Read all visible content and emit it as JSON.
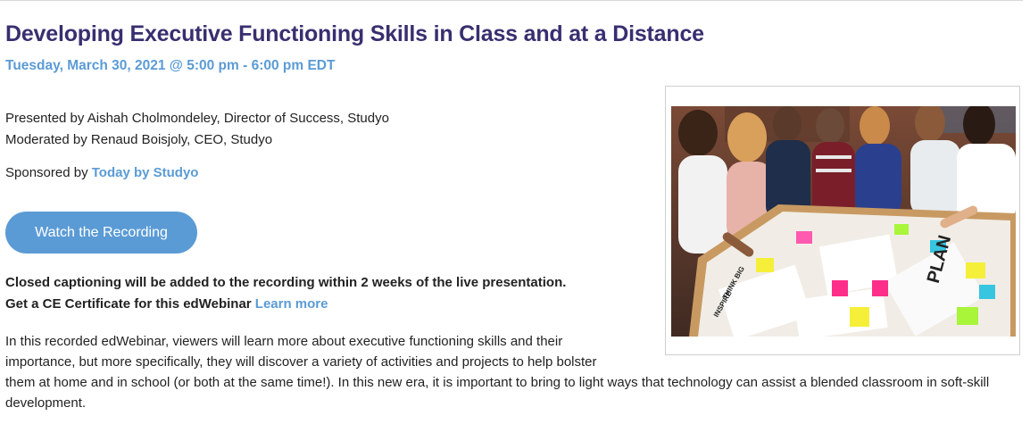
{
  "event": {
    "title": "Developing Executive Functioning Skills in Class and at a Distance",
    "datetime": "Tuesday, March 30, 2021 @ 5:00 pm - 6:00 pm EDT",
    "presented_by": "Presented by Aishah Cholmondeley, Director of Success, Studyo",
    "moderated_by": "Moderated by Renaud Boisjoly, CEO, Studyo",
    "sponsor_prefix": "Sponsored by ",
    "sponsor_link": "Today by Studyo",
    "watch_button": "Watch the Recording",
    "caption_note": "Closed captioning will be added to the recording within 2 weeks of the live presentation.",
    "ce_text": "Get a CE Certificate for this edWebinar ",
    "ce_link": "Learn more",
    "description": "In this recorded edWebinar, viewers will learn more about executive functioning skills and their importance, but more specifically, they will discover a variety of activities and projects to help bolster them at home and in school (or both at the same time!). In this new era, it is important to bring to light ways that technology can assist a blended classroom in soft-skill development."
  },
  "image": {
    "sticky_text": [
      "PLAN",
      "THINK BIG",
      "INSPIRE"
    ]
  },
  "colors": {
    "title": "#382f70",
    "accent": "#5b9bd5"
  }
}
